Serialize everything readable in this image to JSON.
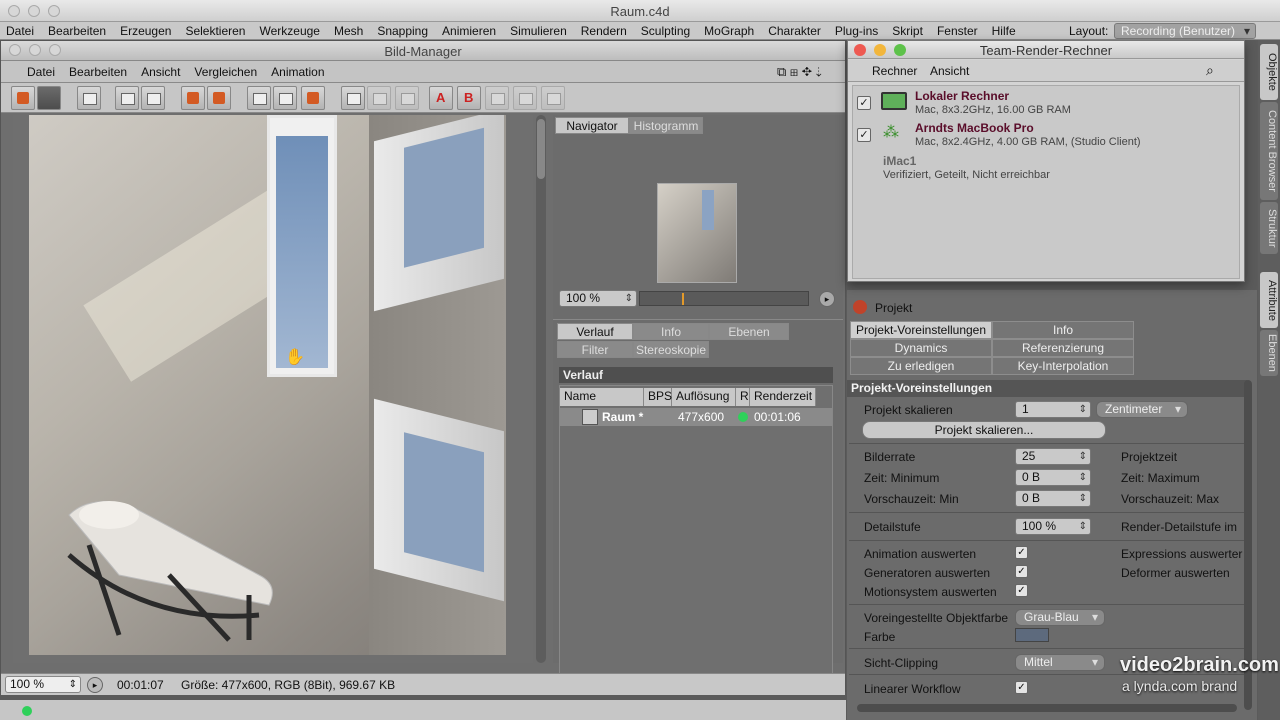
{
  "app": {
    "window_title": "Raum.c4d",
    "menu": [
      "Datei",
      "Bearbeiten",
      "Erzeugen",
      "Selektieren",
      "Werkzeuge",
      "Mesh",
      "Snapping",
      "Animieren",
      "Simulieren",
      "Rendern",
      "Sculpting",
      "MoGraph",
      "Charakter",
      "Plug-ins",
      "Skript",
      "Fenster",
      "Hilfe"
    ],
    "layout_label": "Layout:",
    "layout_value": "Recording (Benutzer)"
  },
  "bild_manager": {
    "title": "Bild-Manager",
    "menu": [
      "Datei",
      "Bearbeiten",
      "Ansicht",
      "Vergleichen",
      "Animation"
    ],
    "navigator_tabs": [
      "Navigator",
      "Histogramm"
    ],
    "zoom": "100 %",
    "info_tabs": [
      "Verlauf",
      "Info",
      "Ebenen",
      "Filter",
      "Stereoskopie"
    ],
    "verlauf_header": "Verlauf",
    "columns": [
      "Name",
      "BPS",
      "Auflösung",
      "R",
      "Renderzeit"
    ],
    "rows": [
      {
        "name": "Raum *",
        "bps": "",
        "resolution": "477x600",
        "rendertime": "00:01:06"
      }
    ],
    "status_zoom": "100 %",
    "status_time": "00:01:07",
    "status_info": "Größe: 477x600, RGB (8Bit), 969.67 KB"
  },
  "team_render": {
    "title": "Team-Render-Rechner",
    "menu": [
      "Rechner",
      "Ansicht"
    ],
    "machines": [
      {
        "name": "Lokaler Rechner",
        "info": "Mac, 8x3.2GHz, 16.00 GB RAM"
      },
      {
        "name": "Arndts MacBook Pro",
        "info": "Mac, 8x2.4GHz, 4.00 GB RAM, (Studio Client)"
      },
      {
        "name": "iMac1",
        "info": "Verifiziert, Geteilt, Nicht erreichbar"
      }
    ]
  },
  "attributes": {
    "object": "Projekt",
    "tabs": [
      "Projekt-Voreinstellungen",
      "Info",
      "Dynamics",
      "Referenzierung",
      "Zu erledigen",
      "Key-Interpolation"
    ],
    "section": "Projekt-Voreinstellungen",
    "projekt_skalieren_label": "Projekt skalieren",
    "projekt_skalieren_value": "1",
    "unit": "Zentimeter",
    "scale_button": "Projekt skalieren...",
    "bilderrate_label": "Bilderrate",
    "bilderrate_value": "25",
    "zeit_min_label": "Zeit: Minimum",
    "zeit_min_value": "0 B",
    "vorschau_min_label": "Vorschauzeit: Min",
    "vorschau_min_value": "0 B",
    "projektzeit_label": "Projektzeit",
    "zeit_max_label": "Zeit: Maximum",
    "vorschau_max_label": "Vorschauzeit: Max",
    "detail_label": "Detailstufe",
    "detail_value": "100 %",
    "render_detail_label": "Render-Detailstufe im",
    "anim_label": "Animation auswerten",
    "gen_label": "Generatoren auswerten",
    "motion_label": "Motionsystem auswerten",
    "expr_label": "Expressions auswerter",
    "deformer_label": "Deformer auswerten",
    "objfarbe_label": "Voreingestellte Objektfarbe",
    "objfarbe_value": "Grau-Blau",
    "farbe_label": "Farbe",
    "clipping_label": "Sicht-Clipping",
    "clipping_value": "Mittel",
    "linear_label": "Linearer Workflow"
  },
  "side_tabs": [
    "Objekte",
    "Content Browser",
    "Struktur",
    "Attribute",
    "Ebenen"
  ],
  "watermark": {
    "line1": "video2brain.com",
    "line2": "a lynda.com brand"
  },
  "colors": {
    "ok_status": "#2fd05a",
    "machine_name": "#5a0d2a",
    "farbe_swatch": "#5d6a7d"
  }
}
